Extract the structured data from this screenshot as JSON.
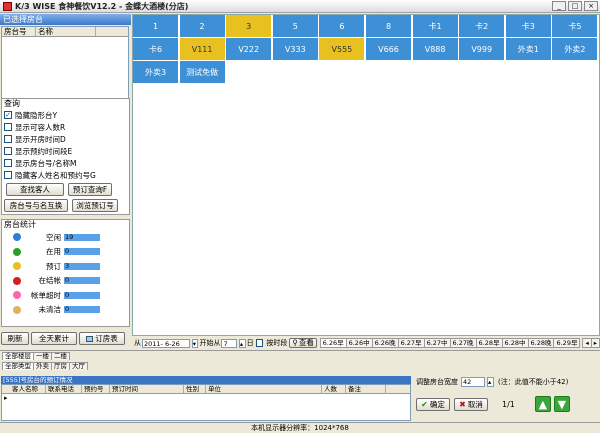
{
  "window": {
    "title": "K/3 WISE 食神餐饮V12.2 - 金蝶大酒楼(分店)",
    "buttons": [
      "_",
      "□",
      "×"
    ]
  },
  "left": {
    "selected_header": "已选择房台",
    "selected_columns": [
      "房台号",
      "名称"
    ],
    "query_title": "查询",
    "options": [
      {
        "label": "隐藏隐形台Y",
        "checked": true
      },
      {
        "label": "显示可容人数R",
        "checked": false
      },
      {
        "label": "显示开房时间D",
        "checked": false
      },
      {
        "label": "显示预约时间段E",
        "checked": false
      },
      {
        "label": "显示房台号/名称M",
        "checked": false
      },
      {
        "label": "隐藏客人姓名和预约号G",
        "checked": false
      }
    ],
    "btn_find_guest": "查找客人",
    "btn_reserve_query": "预订查询F",
    "btn_swap": "房台号与名互换",
    "btn_browse": "浏览预订号",
    "stats_title": "房台统计",
    "stats": [
      {
        "label": "空闲",
        "value": "19",
        "color": "#2f7fd0"
      },
      {
        "label": "在用",
        "value": "0",
        "color": "#28a028"
      },
      {
        "label": "预订",
        "value": "3",
        "color": "#e8c020"
      },
      {
        "label": "在结帐",
        "value": "0",
        "color": "#d02020"
      },
      {
        "label": "帐单超时",
        "value": "0",
        "color": "#ff66aa"
      },
      {
        "label": "未清洁",
        "value": "0",
        "color": "#e0b060"
      }
    ],
    "btn_refresh": "刷新",
    "btn_all_day": "全天累计",
    "btn_room_table": "订房表"
  },
  "rooms": [
    {
      "label": "1",
      "status": "blue"
    },
    {
      "label": "2",
      "status": "blue"
    },
    {
      "label": "3",
      "status": "yellow"
    },
    {
      "label": "5",
      "status": "blue"
    },
    {
      "label": "6",
      "status": "blue"
    },
    {
      "label": "8",
      "status": "blue"
    },
    {
      "label": "卡1",
      "status": "blue"
    },
    {
      "label": "卡2",
      "status": "blue"
    },
    {
      "label": "卡3",
      "status": "blue"
    },
    {
      "label": "卡5",
      "status": "blue"
    },
    {
      "label": "卡6",
      "status": "blue"
    },
    {
      "label": "V111",
      "status": "yellow"
    },
    {
      "label": "V222",
      "status": "blue"
    },
    {
      "label": "V333",
      "status": "blue"
    },
    {
      "label": "V555",
      "status": "yellow"
    },
    {
      "label": "V666",
      "status": "blue"
    },
    {
      "label": "V888",
      "status": "blue"
    },
    {
      "label": "V999",
      "status": "blue"
    },
    {
      "label": "外卖1",
      "status": "blue"
    },
    {
      "label": "外卖2",
      "status": "blue"
    },
    {
      "label": "外卖3",
      "status": "blue"
    },
    {
      "label": "测试免做",
      "status": "blue"
    }
  ],
  "datestrip": {
    "from_label": "从",
    "date_value": "2011- 6-26",
    "open_label": "开始从",
    "open_value": "7",
    "day_label": "日",
    "by_period": "按时段",
    "view_label": "查看",
    "dates": [
      "6.26早",
      "6.26中",
      "6.26晚",
      "6.27早",
      "6.27中",
      "6.27晚",
      "6.28早",
      "6.28中",
      "6.28晚",
      "6.29早"
    ]
  },
  "bottom": {
    "tabs1": [
      "全部楼层",
      "一楼",
      "二楼"
    ],
    "tabs2": [
      "全部类型",
      "外卖",
      "厅房",
      "大厅"
    ],
    "reserve_header": "[555]号房台的预订情况",
    "reserve_columns": [
      "客人名称",
      "联系电话",
      "预约号",
      "预订时间",
      "性别",
      "单位",
      "人数",
      "备注"
    ],
    "width_label": "调整房台宽度",
    "width_value": "42",
    "width_hint": "(注：此值不能小于42)",
    "ok": "确定",
    "cancel": "取消",
    "page": "1/1"
  },
  "status": "本机显示器分辨率：1024*768"
}
